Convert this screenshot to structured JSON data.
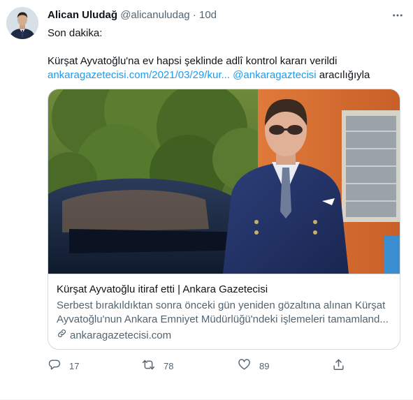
{
  "tweet": {
    "display_name": "Alican Uludağ",
    "handle": "@alicanuludag",
    "separator": "·",
    "time": "10d",
    "text": {
      "line1": "Son dakika:",
      "line2": "Kürşat Ayvatoğlu'na ev hapsi şeklinde adlî kontrol kararı verildi",
      "link": "ankaragazetecisi.com/2021/03/29/kur...",
      "mention": "@ankaragaztecisi",
      "via": "aracılığıyla"
    },
    "card": {
      "title": "Kürşat Ayvatoğlu itiraf etti | Ankara Gazetecisi",
      "description_line1": "Serbest bırakıldıktan sonra önceki gün yeniden gözaltına alınan Kürşat",
      "description_line2": "Ayvatoğlu'nun Ankara Emniyet Müdürlüğü'ndeki işlemeleri tamamland...",
      "domain": "ankaragazetecisi.com",
      "domain_icon": "link-icon"
    },
    "actions": {
      "reply_count": "17",
      "retweet_count": "78",
      "like_count": "89"
    },
    "icons": {
      "more": "more-icon",
      "reply": "reply-icon",
      "retweet": "retweet-icon",
      "like": "like-icon",
      "share": "share-icon"
    },
    "colors": {
      "link": "#1d9bf0",
      "secondary_text": "#536471",
      "primary_text": "#0f1419",
      "border": "#cfd9de"
    }
  }
}
